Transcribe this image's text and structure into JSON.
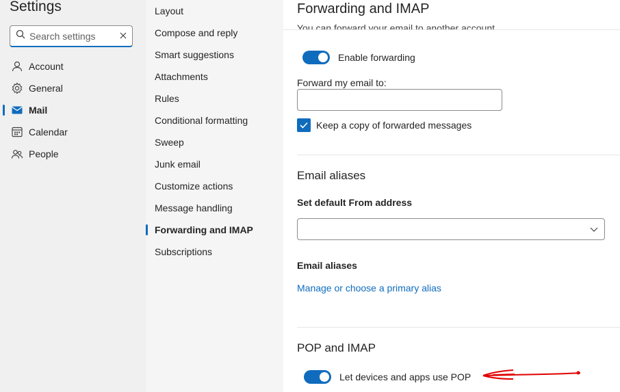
{
  "left": {
    "title": "Settings",
    "search": {
      "placeholder": "Search settings"
    },
    "nav": [
      {
        "label": "Account",
        "icon": "person-icon"
      },
      {
        "label": "General",
        "icon": "gear-icon"
      },
      {
        "label": "Mail",
        "icon": "mail-icon",
        "active": true
      },
      {
        "label": "Calendar",
        "icon": "calendar-icon"
      },
      {
        "label": "People",
        "icon": "people-icon"
      }
    ]
  },
  "mid": {
    "items": [
      "Layout",
      "Compose and reply",
      "Smart suggestions",
      "Attachments",
      "Rules",
      "Conditional formatting",
      "Sweep",
      "Junk email",
      "Customize actions",
      "Message handling",
      "Forwarding and IMAP",
      "Subscriptions"
    ],
    "active_index": 10
  },
  "right": {
    "title": "Forwarding and IMAP",
    "intro": "You can forward your email to another account.",
    "enable_forwarding": "Enable forwarding",
    "forward_to_label": "Forward my email to:",
    "forward_to_value": "",
    "keep_copy": "Keep a copy of forwarded messages",
    "aliases_title": "Email aliases",
    "default_from_label": "Set default From address",
    "default_from_value": "",
    "aliases_label": "Email aliases",
    "manage_link": "Manage or choose a primary alias",
    "pop_title": "POP and IMAP",
    "pop_toggle": "Let devices and apps use POP"
  },
  "colors": {
    "accent": "#0f6cbd",
    "annotation": "#e00000"
  }
}
